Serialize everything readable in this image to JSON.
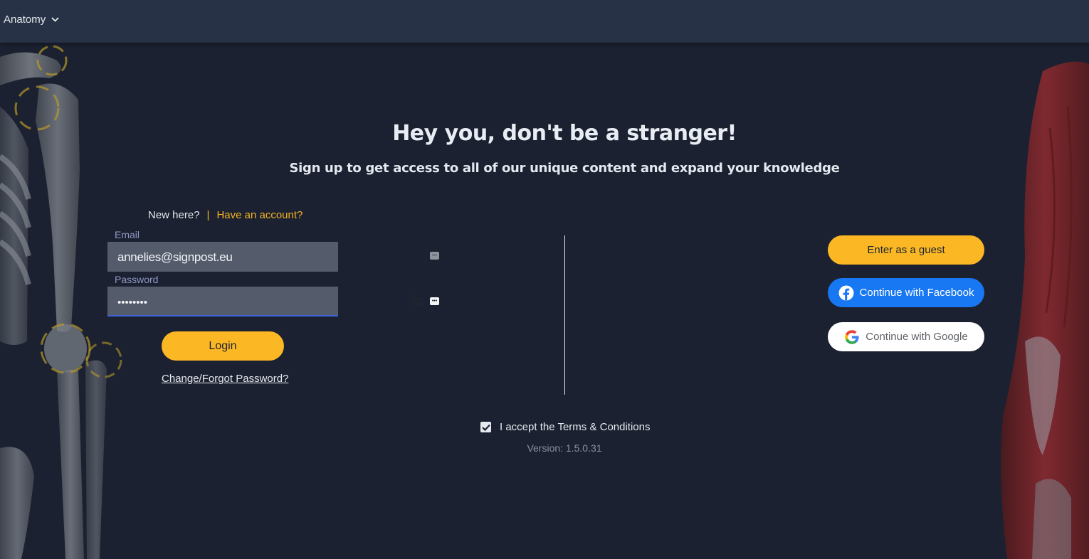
{
  "header": {
    "app_menu_label": "Anatomy",
    "app_menu_icon": "chevron-down-icon"
  },
  "hero": {
    "title": "Hey you, don't be a stranger!",
    "subtitle": "Sign up to get access to all of our unique content and expand your knowledge"
  },
  "auth_tabs": {
    "new_here": "New here?",
    "separator": "|",
    "have_account": "Have an account?"
  },
  "form": {
    "email_label": "Email",
    "email_value": "annelies@signpost.eu",
    "password_label": "Password",
    "password_value": "••••••••",
    "login_label": "Login",
    "forgot_label": "Change/Forgot Password?"
  },
  "social": {
    "guest_label": "Enter as a guest",
    "facebook_label": "Continue with Facebook",
    "google_label": "Continue with Google"
  },
  "footer": {
    "terms_label": "I accept the Terms & Conditions",
    "terms_checked": true,
    "version": "Version: 1.5.0.31"
  },
  "colors": {
    "background": "#1b2130",
    "topbar": "#273246",
    "accent": "#fbb824",
    "facebook": "#1877f2",
    "label": "#8f97c4"
  }
}
